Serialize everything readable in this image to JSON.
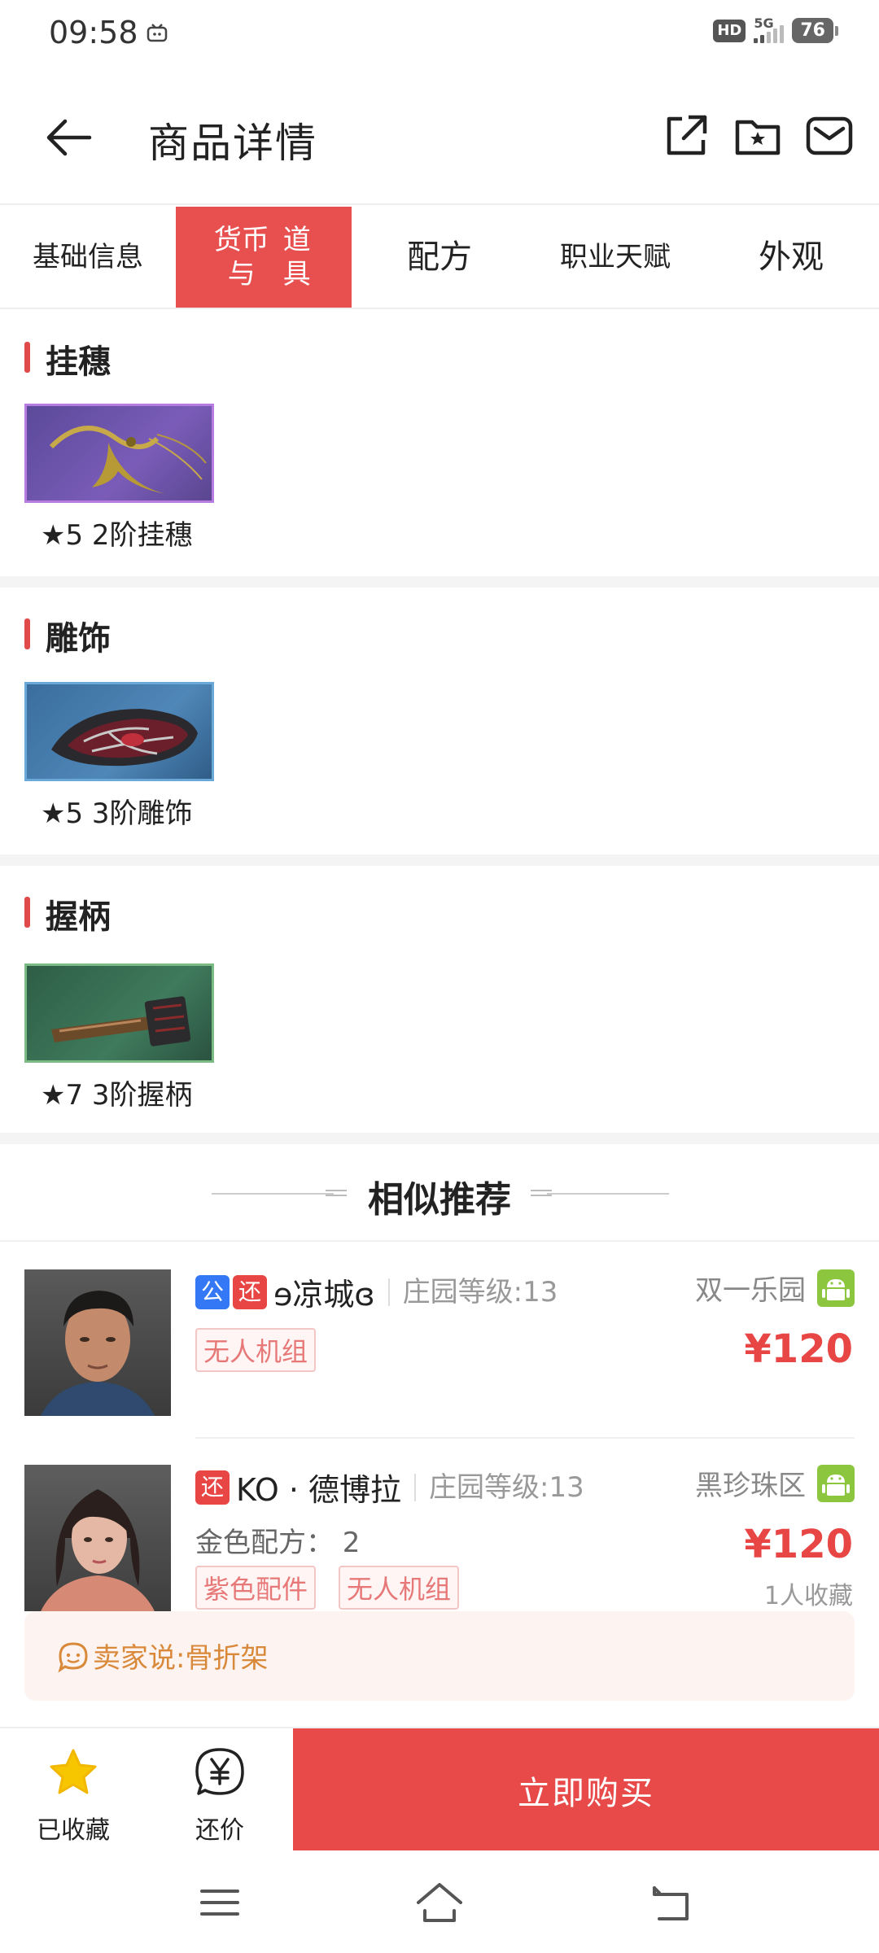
{
  "status_bar": {
    "time": "09:58",
    "hd": "HD",
    "network": "5G",
    "battery": "76"
  },
  "header": {
    "title": "商品详情",
    "icons": [
      "back-arrow-icon",
      "share-icon",
      "favorite-folder-icon",
      "mail-icon"
    ]
  },
  "tabs": [
    {
      "label": "基础信息",
      "active": false
    },
    {
      "label": "货币与道具",
      "active": true
    },
    {
      "label": "配方",
      "active": false
    },
    {
      "label": "职业天赋",
      "active": false
    },
    {
      "label": "外观",
      "active": false
    }
  ],
  "sections": [
    {
      "title": "挂穗",
      "item_label": "★5 2阶挂穗",
      "border_color": "#b77ce0"
    },
    {
      "title": "雕饰",
      "item_label": "★5 3阶雕饰",
      "border_color": "#6aa8d8"
    },
    {
      "title": "握柄",
      "item_label": "★7 3阶握柄",
      "border_color": "#7dbb84"
    }
  ],
  "recommend": {
    "title": "相似推荐",
    "cards": [
      {
        "badges": [
          "公",
          "还"
        ],
        "name": "ɘ凉城ɞ",
        "level": "庄园等级:13",
        "server": "双一乐园",
        "price": "¥120",
        "tags": [
          "无人机组"
        ]
      },
      {
        "badges": [
          "还"
        ],
        "name": "KO · 德博拉",
        "level": "庄园等级:13",
        "server": "黑珍珠区",
        "price": "¥120",
        "extra": "金色配方：  2",
        "tags": [
          "紫色配件",
          "无人机组"
        ],
        "favorites": "1人收藏"
      }
    ],
    "seller_says": "卖家说:骨折架"
  },
  "bottom_bar": {
    "favorited_label": "已收藏",
    "bargain_label": "还价",
    "buy_label": "立即购买"
  },
  "colors": {
    "accent": "#e84a4a",
    "star": "#f7c600",
    "android": "#8cc63f"
  }
}
